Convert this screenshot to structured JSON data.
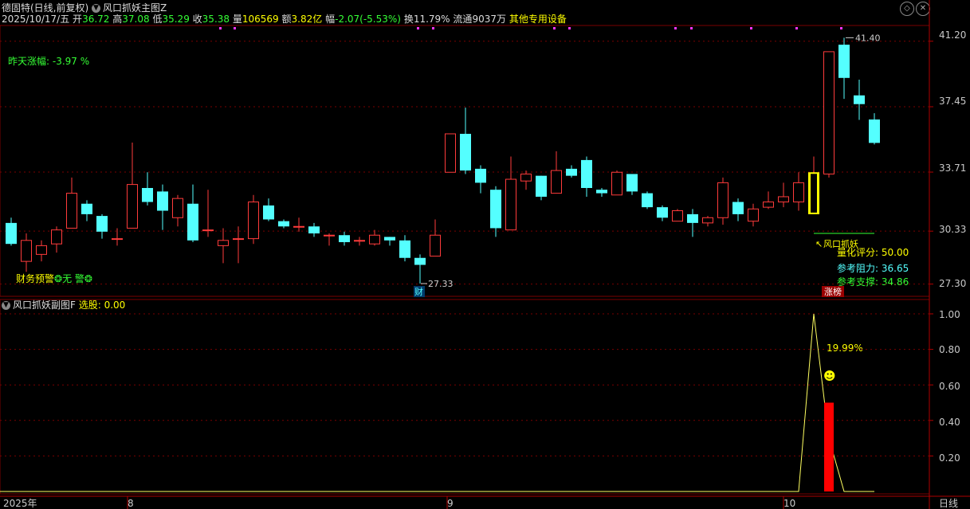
{
  "header": {
    "stock_name": "德固特(日线,前复权)",
    "main_indicator": "风口抓妖主图Z",
    "date": "2025/10/17/五",
    "open_label": "开",
    "open_value": "36.72",
    "high_label": "高",
    "high_value": "37.08",
    "low_label": "低",
    "low_value": "35.29",
    "close_label": "收",
    "close_value": "35.38",
    "volume_label": "量",
    "volume_value": "106569",
    "amount_label": "额",
    "amount_value": "3.82亿",
    "change_label": "幅",
    "change_value": "-2.07(-5.53%)",
    "turnover_label": "换",
    "turnover_value": "11.79%",
    "float_label": "流通",
    "float_value": "9037万",
    "sector": "其他专用设备"
  },
  "main_panel": {
    "yesterday_change": "昨天涨幅: -3.97 %",
    "finance_warning": "财务预警",
    "finance_warning_value": "无 警",
    "finance_marker": "财",
    "low_marker": "27.33",
    "high_marker": "41.40",
    "signal_label": "风口抓妖",
    "score": "量化评分: 50.00",
    "resistance": "参考阻力: 36.65",
    "support": "参考支撑: 34.86",
    "limit_up_tag": "涨榜"
  },
  "price_axis": [
    "41.20",
    "37.45",
    "33.71",
    "30.33",
    "27.30"
  ],
  "sub_panel": {
    "title": "风口抓妖副图F",
    "select_label": "选股: 0.00",
    "peak_pct": "19.99%",
    "axis": [
      "1.00",
      "0.80",
      "0.60",
      "0.40",
      "0.20"
    ]
  },
  "time_axis": {
    "labels": [
      "2025年",
      "8",
      "9",
      "10"
    ],
    "period": "日线"
  },
  "colors": {
    "up": "#ff3b3b",
    "down": "#54ffff",
    "grid": "#7a0000",
    "yellow": "#ffff00",
    "green": "#35ff35",
    "magenta": "#ff35ff"
  },
  "chart_data": {
    "type": "candlestick",
    "ylim": [
      26.6,
      42.1
    ],
    "candles": [
      {
        "o": 30.8,
        "c": 29.6,
        "h": 31.1,
        "l": 29.5
      },
      {
        "o": 28.6,
        "c": 29.8,
        "h": 30.2,
        "l": 28.0
      },
      {
        "o": 29.0,
        "c": 29.5,
        "h": 29.8,
        "l": 28.6
      },
      {
        "o": 29.6,
        "c": 30.4,
        "h": 30.6,
        "l": 29.1
      },
      {
        "o": 30.5,
        "c": 32.5,
        "h": 33.4,
        "l": 30.5
      },
      {
        "o": 31.9,
        "c": 31.3,
        "h": 32.1,
        "l": 30.9
      },
      {
        "o": 31.2,
        "c": 30.3,
        "h": 31.3,
        "l": 29.9
      },
      {
        "o": 29.9,
        "c": 29.9,
        "h": 30.5,
        "l": 29.5
      },
      {
        "o": 30.5,
        "c": 33.0,
        "h": 35.4,
        "l": 30.5
      },
      {
        "o": 32.8,
        "c": 32.0,
        "h": 33.7,
        "l": 31.8
      },
      {
        "o": 32.6,
        "c": 31.5,
        "h": 33.0,
        "l": 30.4
      },
      {
        "o": 31.1,
        "c": 32.2,
        "h": 32.4,
        "l": 30.6
      },
      {
        "o": 31.9,
        "c": 29.8,
        "h": 33.0,
        "l": 29.7
      },
      {
        "o": 30.4,
        "c": 30.4,
        "h": 32.7,
        "l": 30.0
      },
      {
        "o": 29.5,
        "c": 29.8,
        "h": 30.5,
        "l": 28.5
      },
      {
        "o": 29.9,
        "c": 29.9,
        "h": 30.6,
        "l": 28.5
      },
      {
        "o": 29.9,
        "c": 32.0,
        "h": 32.4,
        "l": 29.6
      },
      {
        "o": 31.8,
        "c": 31.0,
        "h": 32.2,
        "l": 30.9
      },
      {
        "o": 30.9,
        "c": 30.6,
        "h": 31.0,
        "l": 30.5
      },
      {
        "o": 30.6,
        "c": 30.6,
        "h": 31.1,
        "l": 30.3
      },
      {
        "o": 30.6,
        "c": 30.2,
        "h": 30.8,
        "l": 30.0
      },
      {
        "o": 30.1,
        "c": 30.1,
        "h": 30.2,
        "l": 29.5
      },
      {
        "o": 30.1,
        "c": 29.7,
        "h": 30.3,
        "l": 29.5
      },
      {
        "o": 29.8,
        "c": 29.8,
        "h": 30.0,
        "l": 29.5
      },
      {
        "o": 29.6,
        "c": 30.1,
        "h": 30.4,
        "l": 29.5
      },
      {
        "o": 30.0,
        "c": 29.8,
        "h": 30.0,
        "l": 29.5
      },
      {
        "o": 29.8,
        "c": 28.8,
        "h": 30.1,
        "l": 28.6
      },
      {
        "o": 28.8,
        "c": 28.4,
        "h": 29.0,
        "l": 27.33
      },
      {
        "o": 28.9,
        "c": 30.1,
        "h": 31.0,
        "l": 28.9
      },
      {
        "o": 33.7,
        "c": 35.9,
        "h": 35.9,
        "l": 33.7
      },
      {
        "o": 35.9,
        "c": 33.8,
        "h": 37.4,
        "l": 33.6
      },
      {
        "o": 33.9,
        "c": 33.1,
        "h": 34.1,
        "l": 32.5
      },
      {
        "o": 32.7,
        "c": 30.5,
        "h": 32.9,
        "l": 30.0
      },
      {
        "o": 30.4,
        "c": 33.3,
        "h": 34.6,
        "l": 30.4
      },
      {
        "o": 33.2,
        "c": 33.6,
        "h": 33.8,
        "l": 32.7
      },
      {
        "o": 33.5,
        "c": 32.3,
        "h": 33.5,
        "l": 32.1
      },
      {
        "o": 32.5,
        "c": 33.8,
        "h": 34.9,
        "l": 32.5
      },
      {
        "o": 33.9,
        "c": 33.5,
        "h": 34.1,
        "l": 33.4
      },
      {
        "o": 34.4,
        "c": 32.8,
        "h": 34.6,
        "l": 32.3
      },
      {
        "o": 32.7,
        "c": 32.5,
        "h": 32.8,
        "l": 32.3
      },
      {
        "o": 32.4,
        "c": 33.7,
        "h": 33.8,
        "l": 32.4
      },
      {
        "o": 33.6,
        "c": 32.6,
        "h": 33.6,
        "l": 32.4
      },
      {
        "o": 32.5,
        "c": 31.7,
        "h": 32.6,
        "l": 31.6
      },
      {
        "o": 31.7,
        "c": 31.1,
        "h": 31.8,
        "l": 30.9
      },
      {
        "o": 30.9,
        "c": 31.5,
        "h": 31.6,
        "l": 30.9
      },
      {
        "o": 31.3,
        "c": 30.8,
        "h": 31.6,
        "l": 30.0
      },
      {
        "o": 30.8,
        "c": 31.1,
        "h": 31.2,
        "l": 30.6
      },
      {
        "o": 31.1,
        "c": 33.1,
        "h": 33.4,
        "l": 30.7
      },
      {
        "o": 32.0,
        "c": 31.3,
        "h": 32.2,
        "l": 30.9
      },
      {
        "o": 30.9,
        "c": 31.6,
        "h": 31.9,
        "l": 30.6
      },
      {
        "o": 31.7,
        "c": 32.0,
        "h": 32.6,
        "l": 31.6
      },
      {
        "o": 32.0,
        "c": 32.3,
        "h": 33.1,
        "l": 31.7
      },
      {
        "o": 32.0,
        "c": 33.1,
        "h": 33.7,
        "l": 31.5
      },
      {
        "o": 31.3,
        "c": 33.7,
        "h": 34.6,
        "l": 31.3
      },
      {
        "o": 33.6,
        "c": 40.6,
        "h": 40.6,
        "l": 33.4
      },
      {
        "o": 41.0,
        "c": 39.1,
        "h": 41.4,
        "l": 37.9
      },
      {
        "o": 38.1,
        "c": 37.6,
        "h": 39.0,
        "l": 36.7
      },
      {
        "o": 36.72,
        "c": 35.38,
        "h": 37.08,
        "l": 35.29
      }
    ],
    "signal_candle_index": 53,
    "sub_series": [
      0,
      0,
      0,
      0,
      0,
      0,
      0,
      0,
      0,
      0,
      0,
      0,
      0,
      0,
      0,
      0,
      0,
      0,
      0,
      0,
      0,
      0,
      0,
      0,
      0,
      0,
      0,
      0,
      0,
      0,
      0,
      0,
      0,
      0,
      0,
      0,
      0,
      0,
      0,
      0,
      0,
      0,
      0,
      0,
      0,
      0,
      0,
      0,
      0,
      0,
      0,
      0,
      0,
      1.0,
      0.3,
      0,
      0,
      0
    ],
    "sub_bar": {
      "index": 54,
      "value": 0.5
    },
    "sub_ylim": [
      0,
      1.1
    ]
  }
}
